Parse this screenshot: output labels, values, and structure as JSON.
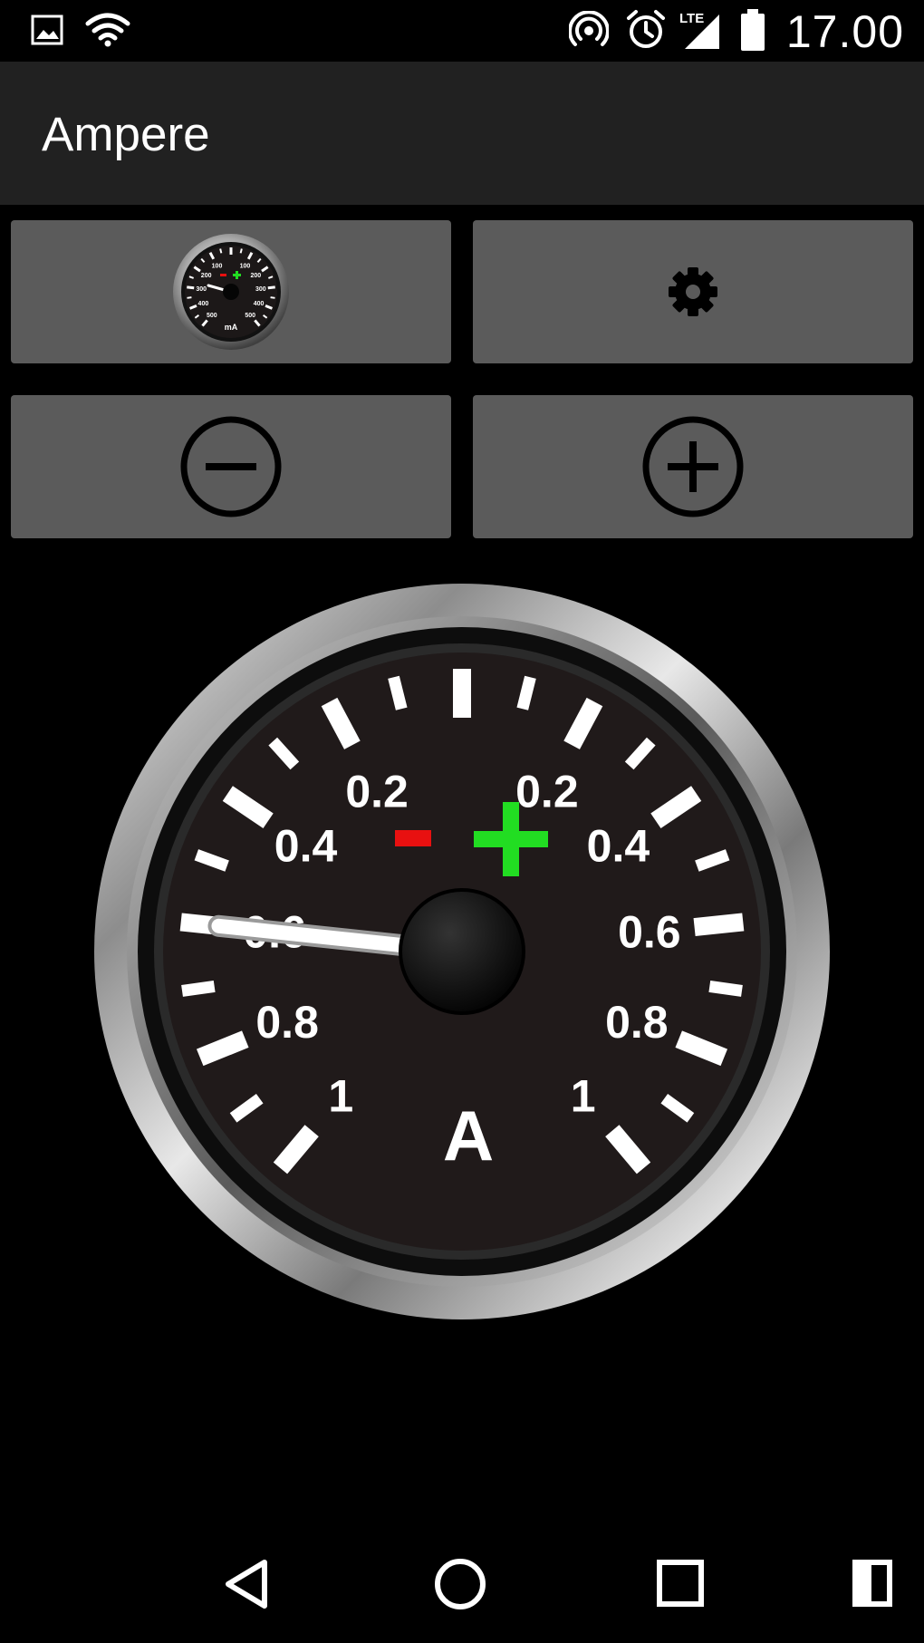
{
  "status_bar": {
    "time": "17.00",
    "network_label": "LTE",
    "icons": [
      "image-notification-icon",
      "wifi-icon",
      "hotspot-icon",
      "alarm-icon",
      "lte-signal-icon",
      "battery-icon"
    ]
  },
  "app_bar": {
    "title": "Ampere"
  },
  "controls": {
    "gauge_select_icon": "mini-gauge-icon",
    "mini_gauge": {
      "left_labels": [
        "100",
        "200",
        "300",
        "400",
        "500"
      ],
      "right_labels": [
        "100",
        "200",
        "300",
        "400",
        "500"
      ],
      "unit": "mA"
    },
    "settings_icon": "gear-icon",
    "decrease_icon": "minus-circle-icon",
    "increase_icon": "plus-circle-icon"
  },
  "gauge": {
    "unit": "A",
    "left_scale_labels": [
      "0.2",
      "0.4",
      "0.6",
      "0.8",
      "1"
    ],
    "right_scale_labels": [
      "0.2",
      "0.4",
      "0.6",
      "0.8",
      "1"
    ],
    "negative_symbol_color": "#e81010",
    "positive_symbol_color": "#22dd22",
    "needle_direction": "negative",
    "needle_value": 0.6
  },
  "nav_bar": {
    "icons": [
      "back-icon",
      "home-icon",
      "recents-icon",
      "split-screen-icon"
    ]
  }
}
